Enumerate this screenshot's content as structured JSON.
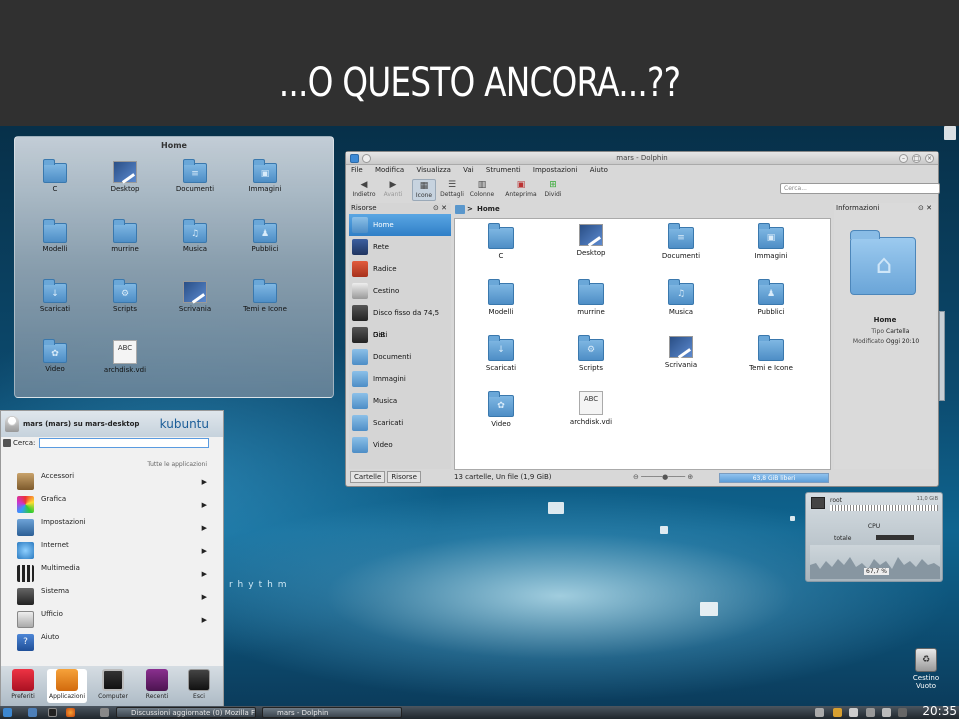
{
  "banner": {
    "title": "...O QUESTO ANCORA...??"
  },
  "folderview": {
    "title": "Home",
    "items": [
      {
        "label": "C",
        "icon": "folder-icon"
      },
      {
        "label": "Desktop",
        "icon": "desktop-icon"
      },
      {
        "label": "Documenti",
        "icon": "folder-documents-icon"
      },
      {
        "label": "Immagini",
        "icon": "folder-images-icon"
      },
      {
        "label": "Modelli",
        "icon": "folder-icon"
      },
      {
        "label": "murrine",
        "icon": "folder-icon"
      },
      {
        "label": "Musica",
        "icon": "folder-music-icon"
      },
      {
        "label": "Pubblici",
        "icon": "folder-public-icon"
      },
      {
        "label": "Scaricati",
        "icon": "folder-download-icon"
      },
      {
        "label": "Scripts",
        "icon": "folder-scripts-icon"
      },
      {
        "label": "Scrivania",
        "icon": "desktop-icon"
      },
      {
        "label": "Temi e Icone",
        "icon": "folder-icon"
      },
      {
        "label": "Video",
        "icon": "folder-video-icon"
      },
      {
        "label": "archdisk.vdi",
        "icon": "vdi-file-icon"
      }
    ]
  },
  "wallpaper": {
    "text": "rhythm"
  },
  "dolphin": {
    "title": "mars - Dolphin",
    "menu": [
      "File",
      "Modifica",
      "Visualizza",
      "Vai",
      "Strumenti",
      "Impostazioni",
      "Aiuto"
    ],
    "toolbar": {
      "back": "Indietro",
      "forward": "Avanti",
      "icons": "Icone",
      "details": "Dettagli",
      "columns": "Colonne",
      "preview": "Anteprima",
      "split": "Dividi",
      "search_placeholder": "Cerca..."
    },
    "places_title": "Risorse",
    "places": [
      "Home",
      "Rete",
      "Radice",
      "Cestino",
      "Disco fisso da 74,5 GiB",
      "Dati",
      "Documenti",
      "Immagini",
      "Musica",
      "Scaricati",
      "Video"
    ],
    "breadcrumb": "Home",
    "info_title": "Informazioni",
    "info": {
      "name": "Home",
      "type_label": "Tipo",
      "type": "Cartella",
      "modified_label": "Modificato",
      "modified": "Oggi 20:10"
    },
    "tabs": [
      "Cartelle",
      "Risorse"
    ],
    "status": "13 cartelle, Un file (1,9 GiB)",
    "free": "63,8 GiB liberi"
  },
  "cpu_widget": {
    "root": "root",
    "size": "11,0 GiB",
    "title": "CPU",
    "total_label": "totale",
    "percent": "67,7 %"
  },
  "trash": {
    "label_1": "Cestino",
    "label_2": "Vuoto"
  },
  "kickoff": {
    "user": "mars (mars) su mars-desktop",
    "brand": "kubuntu",
    "search_label": "Cerca:",
    "all_apps": "Tutte le applicazioni",
    "items": [
      "Accessori",
      "Grafica",
      "Impostazioni",
      "Internet",
      "Multimedia",
      "Sistema",
      "Ufficio",
      "Aiuto"
    ],
    "tabs": [
      "Preferiti",
      "Applicazioni",
      "Computer",
      "Recenti",
      "Esci"
    ]
  },
  "taskbar": {
    "task1": "Discussioni aggiornate (0) Mozilla Fi...",
    "task2": "mars - Dolphin",
    "clock": "20:35"
  },
  "colors": {
    "banner": "#303030",
    "accent": "#2f7fc7",
    "folder": "#5a97cc"
  }
}
